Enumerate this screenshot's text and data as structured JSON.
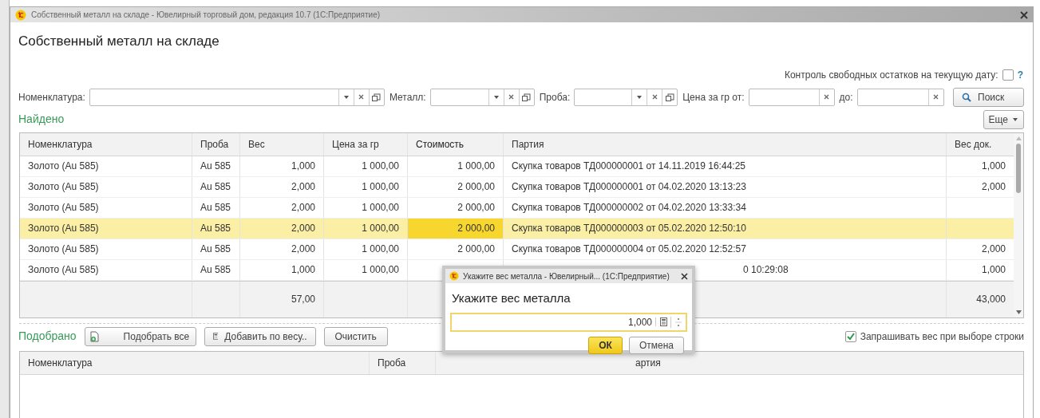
{
  "window": {
    "title": "Собственный металл на складе - Ювелирный торговый дом, редакция 10.7  (1С:Предприятие)"
  },
  "form": {
    "title": "Собственный металл на складе"
  },
  "free_balance_check": {
    "label": "Контроль свободных остатков на текущую дату:",
    "checked": false,
    "help": "?"
  },
  "filters": [
    {
      "label": "Номенклатура:",
      "kind": "select"
    },
    {
      "label": "Металл:",
      "kind": "select"
    },
    {
      "label": "Проба:",
      "kind": "select"
    },
    {
      "label": "Цена за гр от:",
      "kind": "clearable"
    },
    {
      "label": "до:",
      "kind": "clearable"
    }
  ],
  "search_button": "Поиск",
  "found_title": "Найдено",
  "more_button": "Еще",
  "table": {
    "columns": [
      {
        "label": "Номенклатура",
        "kind": "text",
        "focused": false
      },
      {
        "label": "Проба",
        "kind": "text",
        "focused": false
      },
      {
        "label": "Вес",
        "kind": "number",
        "focused": false
      },
      {
        "label": "Цена за гр",
        "kind": "number",
        "focused": false
      },
      {
        "label": "Стоимость",
        "kind": "number",
        "focused": true
      },
      {
        "label": "Партия",
        "kind": "text",
        "focused": false
      },
      {
        "label": "Вес док.",
        "kind": "number",
        "focused": false
      }
    ],
    "rows": [
      {
        "cells": [
          "Золото (Au 585)",
          "Au 585",
          "1,000",
          "1 000,00",
          "1 000,00",
          "Скупка товаров ТД000000001 от 14.11.2019 16:44:25",
          "1,000"
        ],
        "selected": false
      },
      {
        "cells": [
          "Золото (Au 585)",
          "Au 585",
          "2,000",
          "1 000,00",
          "2 000,00",
          "Скупка товаров ТД000000001 от 04.02.2020 13:13:23",
          "2,000"
        ],
        "selected": false
      },
      {
        "cells": [
          "Золото (Au 585)",
          "Au 585",
          "2,000",
          "1 000,00",
          "2 000,00",
          "Скупка товаров ТД000000002 от 04.02.2020 13:33:34",
          null
        ],
        "selected": false
      },
      {
        "cells": [
          "Золото (Au 585)",
          "Au 585",
          "2,000",
          "1 000,00",
          "2 000,00",
          "Скупка товаров ТД000000003 от 05.02.2020 12:50:10",
          null
        ],
        "selected": true
      },
      {
        "cells": [
          "Золото (Au 585)",
          "Au 585",
          "2,000",
          "1 000,00",
          "2 000,00",
          "Скупка товаров ТД000000004 от 05.02.2020 12:52:57",
          "2,000"
        ],
        "selected": false
      },
      {
        "cells": [
          "Золото (Au 585)",
          "Au 585",
          "1,000",
          "1 000,00",
          null,
          "0 10:29:08",
          "1,000"
        ],
        "behind_dialog": true,
        "selected": false
      }
    ],
    "totals": {
      "weight": "57,00",
      "doc_weight": "43,000"
    }
  },
  "picked": {
    "title": "Подобрано",
    "buttons": [
      {
        "label": "Подобрать все",
        "kind": "add-all"
      },
      {
        "label": "Добавить по весу..",
        "kind": "by-weight"
      },
      {
        "label": "Очистить",
        "kind": "plain"
      }
    ],
    "ask_weight": {
      "label": "Запрашивать вес при выборе строки",
      "checked": true
    },
    "columns": [
      {
        "label": "Номенклатура"
      },
      {
        "label": "Проба"
      },
      {
        "label": "артия",
        "behind_dialog": true
      }
    ]
  },
  "dialog": {
    "title": "Укажите вес металла - Ювелирный...  (1С:Предприятие)",
    "heading": "Укажите вес металла",
    "value": "1,000",
    "ok": "ОК",
    "cancel": "Отмена"
  }
}
